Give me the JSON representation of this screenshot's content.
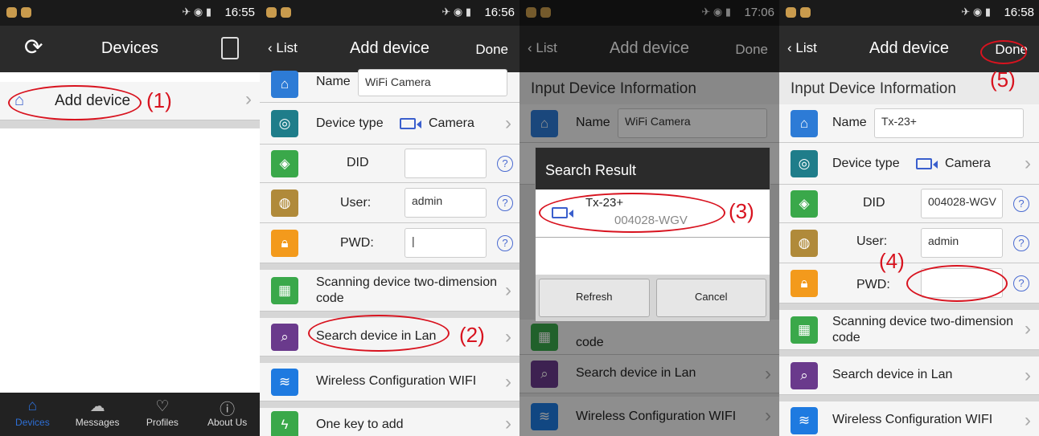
{
  "p1": {
    "time": "16:55",
    "title": "Devices",
    "add_device": "Add device",
    "annot": "(1)",
    "tabs": [
      "Devices",
      "Messages",
      "Profiles",
      "About Us"
    ]
  },
  "p2": {
    "time": "16:56",
    "back": "List",
    "title": "Add device",
    "done": "Done",
    "name_label": "Name",
    "name_value": "WiFi Camera",
    "device_type_label": "Device type",
    "camera": "Camera",
    "did_label": "DID",
    "user_label": "User:",
    "user_value": "admin",
    "pwd_label": "PWD:",
    "scan": "Scanning device two-dimension code",
    "search": "Search device in Lan",
    "annot": "(2)",
    "wifi": "Wireless Configuration WIFI",
    "onekey": "One key to add"
  },
  "p3": {
    "time": "17:06",
    "back": "List",
    "title": "Add device",
    "done": "Done",
    "section": "Input Device Information",
    "name_label": "Name",
    "name_value": "WiFi Camera",
    "dialog_title": "Search Result",
    "result_name": "Tx-23+",
    "result_id": "004028-WGV",
    "annot": "(3)",
    "refresh": "Refresh",
    "cancel": "Cancel",
    "scan_tail": "code",
    "search": "Search device in Lan",
    "wifi": "Wireless Configuration WIFI"
  },
  "p4": {
    "time": "16:58",
    "back": "List",
    "title": "Add device",
    "done": "Done",
    "section": "Input Device Information",
    "annot5": "(5)",
    "name_label": "Name",
    "name_value": "Tx-23+",
    "device_type_label": "Device type",
    "camera": "Camera",
    "did_label": "DID",
    "did_value": "004028-WGV",
    "user_label": "User:",
    "user_value": "admin",
    "pwd_label": "PWD:",
    "annot4": "(4)",
    "scan": "Scanning device two-dimension code",
    "search": "Search device in Lan",
    "wifi": "Wireless Configuration WIFI"
  },
  "colors": {
    "annotation_red": "#d8131f",
    "blue_icon": "#2d7bd6",
    "teal_icon": "#1f7d8a",
    "green_icon": "#3aa84a",
    "brown_icon": "#b08a3a",
    "orange_icon": "#f39a1c",
    "purple_icon": "#6a3a8c"
  }
}
